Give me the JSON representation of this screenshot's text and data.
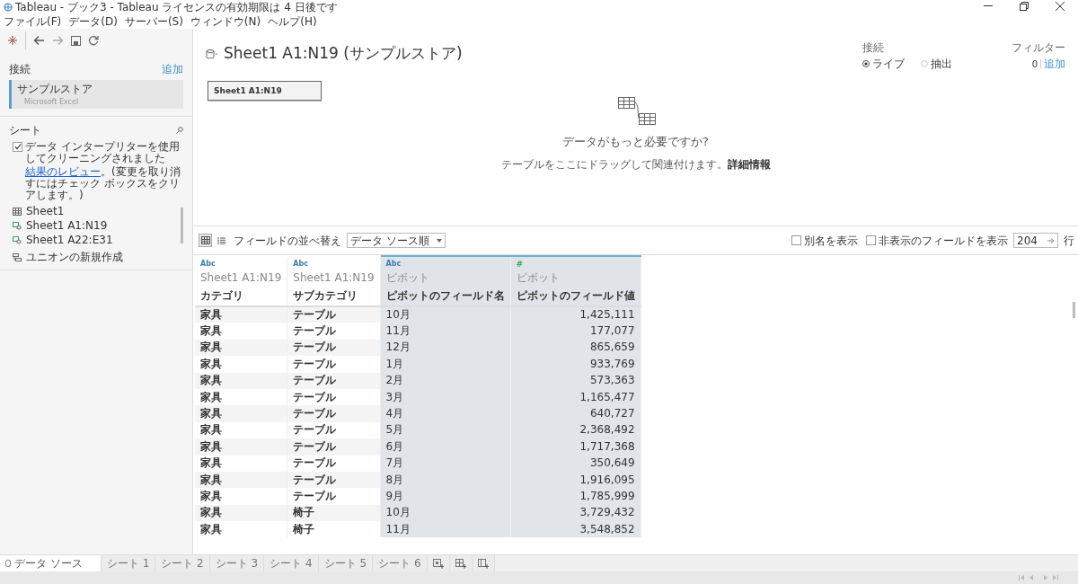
{
  "window": {
    "title": "Tableau - ブック3 - Tableau ライセンスの有効期限は 4 日後です"
  },
  "menu": [
    "ファイル(F)",
    "データ(D)",
    "サーバー(S)",
    "ウィンドウ(N)",
    "ヘルプ(H)"
  ],
  "connections": {
    "heading": "接続",
    "add": "追加",
    "items": [
      {
        "name": "サンプルストア",
        "type": "Microsoft Excel",
        "selected": true
      }
    ]
  },
  "sheets": {
    "heading": "シート",
    "interpreter": {
      "checked": true,
      "label": "データ インタープリターを使用してクリーニングされました",
      "link": "結果のレビュー",
      "note": "。(変更を取り消すにはチェック ボックスをクリアします。)"
    },
    "items": [
      {
        "label": "Sheet1",
        "kind": "sheet"
      },
      {
        "label": "Sheet1 A1:N19",
        "kind": "range"
      },
      {
        "label": "Sheet1 A22:E31",
        "kind": "range"
      }
    ],
    "new_union": "ユニオンの新規作成"
  },
  "canvas": {
    "title": "Sheet1 A1:N19 (サンプルストア)",
    "table_node": "Sheet1 A1:N19",
    "empty_heading": "データがもっと必要ですか?",
    "empty_text": "テーブルをここにドラッグして関連付けます。",
    "empty_link": "詳細情報"
  },
  "connection_mode": {
    "heading": "接続",
    "options": [
      {
        "label": "ライブ",
        "selected": true
      },
      {
        "label": "抽出",
        "selected": false
      }
    ]
  },
  "filters": {
    "heading": "フィルター",
    "count": "0",
    "add": "追加"
  },
  "grid_toolbar": {
    "views": [
      {
        "kind": "grid",
        "selected": true
      },
      {
        "kind": "list",
        "selected": false
      }
    ],
    "sort_label": "フィールドの並べ替え",
    "sort_value": "データ ソース順",
    "show_alias": {
      "label": "別名を表示",
      "checked": false
    },
    "show_hidden": {
      "label": "非表示のフィールドを表示",
      "checked": false
    },
    "rows_value": "204",
    "rows_unit": "行"
  },
  "table": {
    "columns": [
      {
        "type": "Abc",
        "kind": "string",
        "source": "Sheet1 A1:N19",
        "name": "カテゴリ",
        "pivot": false
      },
      {
        "type": "Abc",
        "kind": "string",
        "source": "Sheet1 A1:N19",
        "name": "サブカテゴリ",
        "pivot": false
      },
      {
        "type": "Abc",
        "kind": "string",
        "source": "ピボット",
        "name": "ピボットのフィールド名",
        "pivot": true
      },
      {
        "type": "#",
        "kind": "number",
        "source": "ピボット",
        "name": "ピボットのフィールド値",
        "pivot": true
      }
    ],
    "rows": [
      [
        "家具",
        "テーブル",
        "10月",
        "1,425,111"
      ],
      [
        "家具",
        "テーブル",
        "11月",
        "177,077"
      ],
      [
        "家具",
        "テーブル",
        "12月",
        "865,659"
      ],
      [
        "家具",
        "テーブル",
        "1月",
        "933,769"
      ],
      [
        "家具",
        "テーブル",
        "2月",
        "573,363"
      ],
      [
        "家具",
        "テーブル",
        "3月",
        "1,165,477"
      ],
      [
        "家具",
        "テーブル",
        "4月",
        "640,727"
      ],
      [
        "家具",
        "テーブル",
        "5月",
        "2,368,492"
      ],
      [
        "家具",
        "テーブル",
        "6月",
        "1,717,368"
      ],
      [
        "家具",
        "テーブル",
        "7月",
        "350,649"
      ],
      [
        "家具",
        "テーブル",
        "8月",
        "1,916,095"
      ],
      [
        "家具",
        "テーブル",
        "9月",
        "1,785,999"
      ],
      [
        "家具",
        "椅子",
        "10月",
        "3,729,432"
      ],
      [
        "家具",
        "椅子",
        "11月",
        "3,548,852"
      ]
    ]
  },
  "bottom_tabs": [
    {
      "label": "データ ソース",
      "kind": "source",
      "selected": true
    },
    {
      "label": "シート 1",
      "kind": "sheet",
      "selected": false
    },
    {
      "label": "シート 2",
      "kind": "sheet",
      "selected": false
    },
    {
      "label": "シート 3",
      "kind": "sheet",
      "selected": false
    },
    {
      "label": "シート 4",
      "kind": "sheet",
      "selected": false
    },
    {
      "label": "シート 5",
      "kind": "sheet",
      "selected": false
    },
    {
      "label": "シート 6",
      "kind": "sheet",
      "selected": false
    }
  ]
}
